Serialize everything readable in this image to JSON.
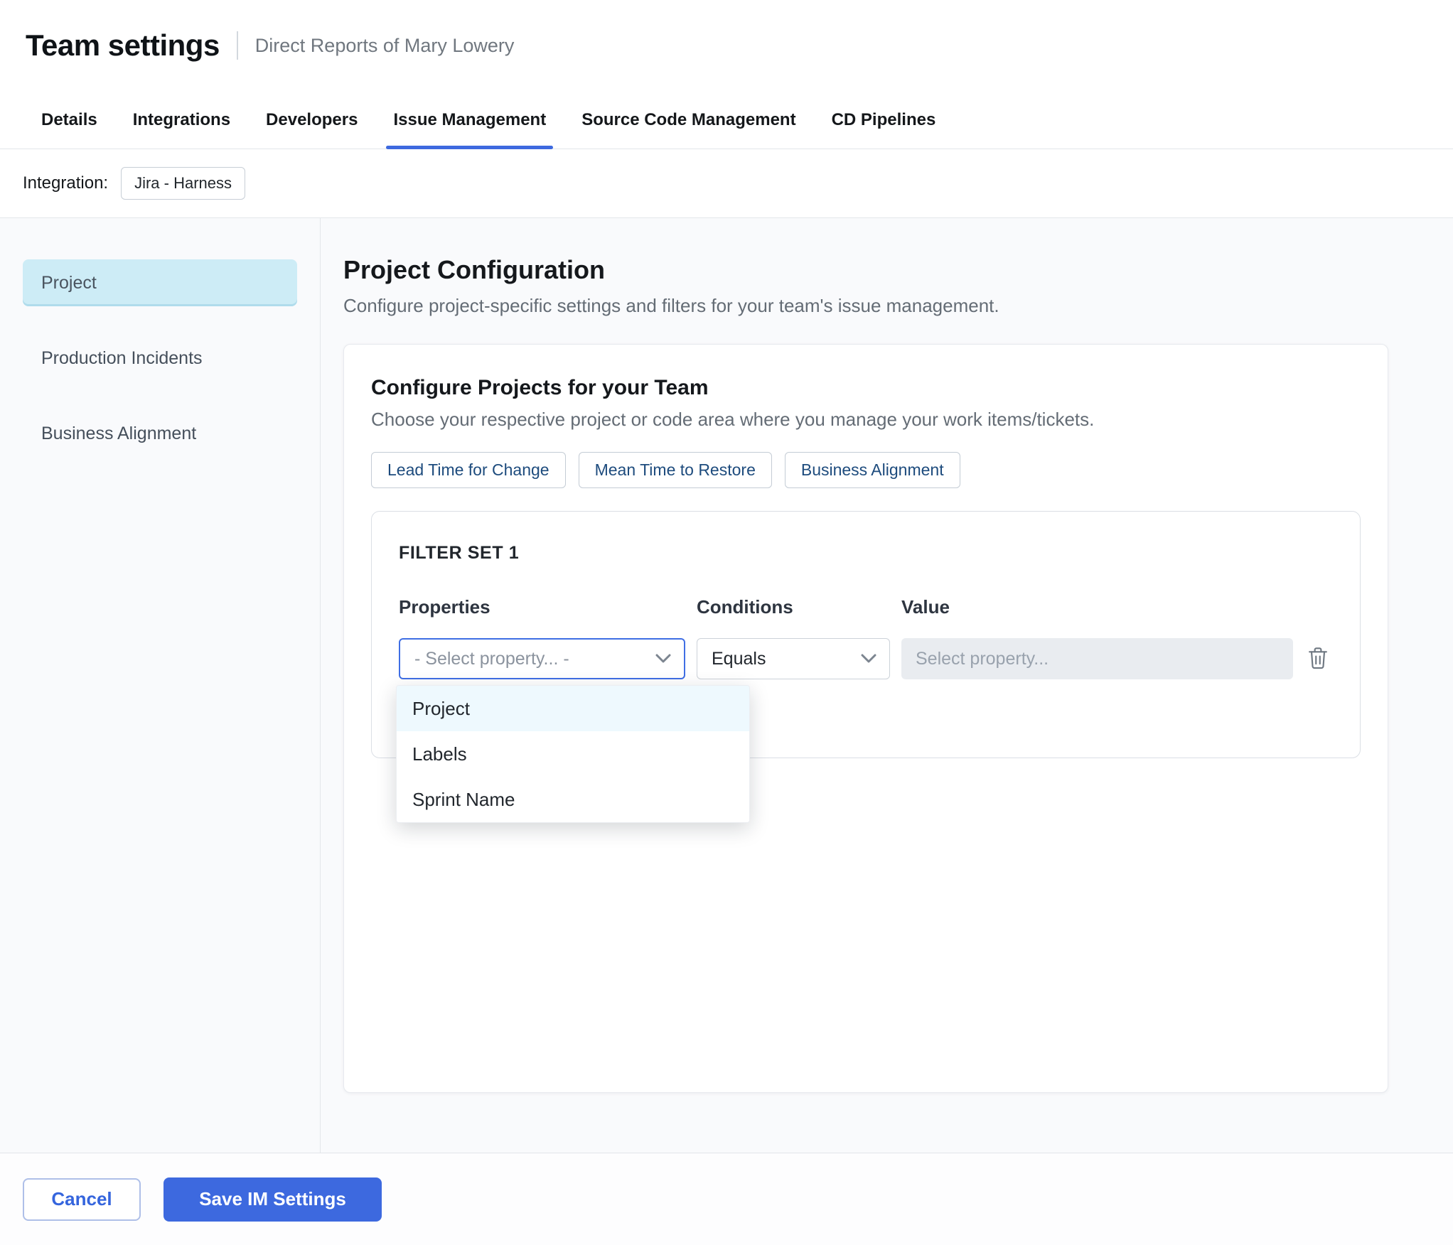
{
  "header": {
    "title": "Team settings",
    "subtitle": "Direct Reports of Mary Lowery"
  },
  "tabs": [
    {
      "label": "Details"
    },
    {
      "label": "Integrations"
    },
    {
      "label": "Developers"
    },
    {
      "label": "Issue Management"
    },
    {
      "label": "Source Code Management"
    },
    {
      "label": "CD Pipelines"
    }
  ],
  "active_tab": "Issue Management",
  "integration": {
    "label": "Integration:",
    "value": "Jira - Harness"
  },
  "sidebar": {
    "items": [
      {
        "label": "Project"
      },
      {
        "label": "Production Incidents"
      },
      {
        "label": "Business Alignment"
      }
    ],
    "active_item": "Project"
  },
  "main": {
    "title": "Project Configuration",
    "description": "Configure project-specific settings and filters for your team's issue management.",
    "card": {
      "title": "Configure Projects for your Team",
      "subtitle": "Choose your respective project or code area where you manage your work items/tickets.",
      "metric_tabs": [
        {
          "label": "Lead Time for Change"
        },
        {
          "label": "Mean Time to Restore"
        },
        {
          "label": "Business Alignment"
        }
      ],
      "filter_set": {
        "title": "FILTER SET 1",
        "properties_label": "Properties",
        "conditions_label": "Conditions",
        "value_label": "Value",
        "property_placeholder": "- Select property... -",
        "condition_selected": "Equals",
        "value_placeholder": "Select property...",
        "dropdown": {
          "options": [
            {
              "label": "Project"
            },
            {
              "label": "Labels"
            },
            {
              "label": "Sprint Name"
            }
          ],
          "highlighted": "Project"
        }
      }
    }
  },
  "footer": {
    "cancel_label": "Cancel",
    "save_label": "Save IM Settings"
  },
  "colors": {
    "primary": "#3d69df",
    "tab_underline": "#3d69df",
    "active_sidebar_bg": "#cdecf6",
    "dropdown_highlight_bg": "#eef9fe",
    "focused_select_border": "#3f6ee4",
    "chip_text": "#1d4b7d"
  }
}
